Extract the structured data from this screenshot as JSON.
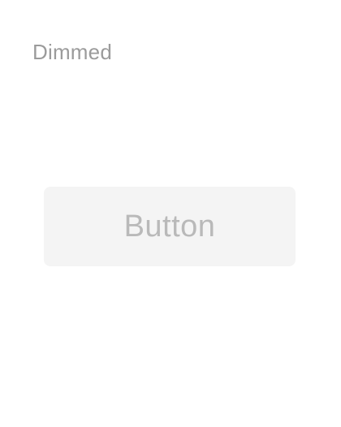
{
  "state": {
    "label": "Dimmed"
  },
  "button": {
    "label": "Button",
    "disabled": true
  },
  "colors": {
    "background": "#ffffff",
    "state_label_text": "#9b9b9b",
    "button_background": "#f4f4f4",
    "button_text": "#b9b9b9"
  }
}
